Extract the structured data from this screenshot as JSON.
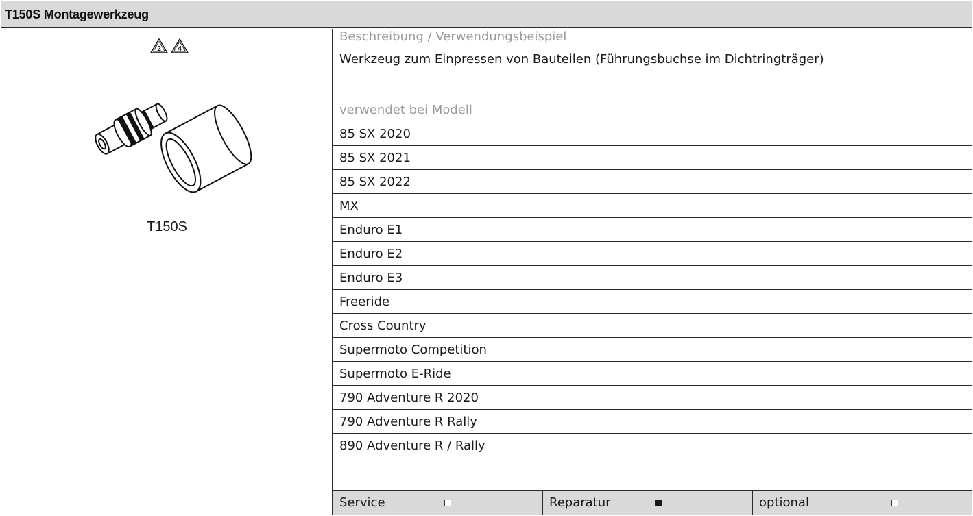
{
  "header": {
    "title": "T150S Montagewerkzeug"
  },
  "tool": {
    "code": "T150S",
    "warning_icons": [
      {
        "icon": "warning-triangle-icon",
        "label": "2"
      },
      {
        "icon": "warning-triangle-icon",
        "label": "4"
      }
    ],
    "illustration_icon": "press-tool-illustration"
  },
  "description": {
    "label": "Beschreibung / Verwendungsbeispiel",
    "text": "Werkzeug zum Einpressen von Bauteilen (Führungsbuchse im Dichtringträger)"
  },
  "models": {
    "label": "verwendet bei Modell",
    "items": [
      "85 SX 2020",
      "85 SX 2021",
      "85 SX 2022",
      "MX",
      "Enduro E1",
      "Enduro E2",
      "Enduro E3",
      "Freeride",
      "Cross Country",
      "Supermoto Competition",
      "Supermoto E-Ride",
      "790 Adventure R 2020",
      "790 Adventure R Rally",
      "890 Adventure R / Rally"
    ]
  },
  "status": {
    "service": {
      "label": "Service",
      "checked": false
    },
    "repair": {
      "label": "Reparatur",
      "checked": true
    },
    "optional": {
      "label": "optional",
      "checked": false
    }
  }
}
